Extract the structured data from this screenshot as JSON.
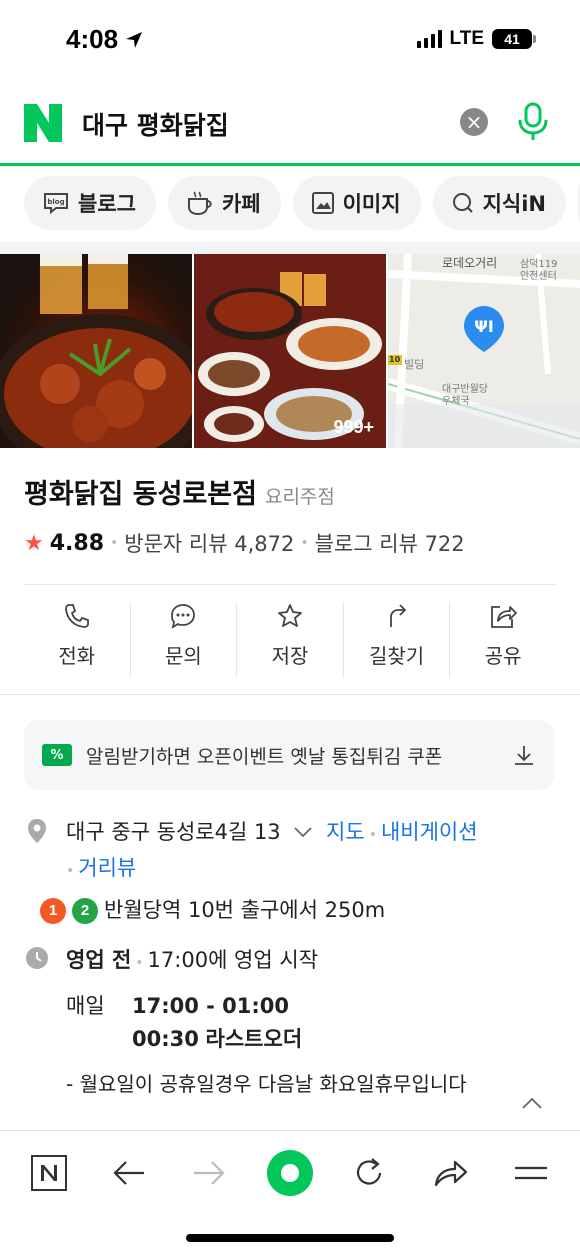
{
  "status_bar": {
    "time": "4:08",
    "network": "LTE",
    "battery": "41"
  },
  "search": {
    "query": "대구 평화닭집",
    "clear_label": "×"
  },
  "chips": [
    {
      "label": "블로그",
      "icon": "blog-icon"
    },
    {
      "label": "카페",
      "icon": "cafe-cup-icon"
    },
    {
      "label": "이미지",
      "icon": "image-icon"
    },
    {
      "label": "지식iN",
      "icon": "knowledge-icon"
    }
  ],
  "photos": {
    "more_count": "999+"
  },
  "map_labels": {
    "street": "로데오거리",
    "fire_station": "삼덕119\n안전센터",
    "bus": "10",
    "building": "빌딩",
    "post_office": "대구반월당\n우체국"
  },
  "place": {
    "name": "평화닭집 동성로본점",
    "category": "요리주점",
    "star": "★",
    "rating": "4.88",
    "visitor_reviews": "방문자 리뷰 4,872",
    "blog_reviews": "블로그 리뷰 722"
  },
  "actions": [
    {
      "label": "전화",
      "icon": "phone-icon"
    },
    {
      "label": "문의",
      "icon": "chat-icon"
    },
    {
      "label": "저장",
      "icon": "star-icon"
    },
    {
      "label": "길찾기",
      "icon": "directions-icon"
    },
    {
      "label": "공유",
      "icon": "share-icon"
    }
  ],
  "coupon": {
    "badge": "%",
    "text": "알림받기하면 오픈이벤트 옛날 통집튀김 쿠폰"
  },
  "address": {
    "text": "대구 중구 동성로4길 13",
    "map_link": "지도",
    "nav_link": "내비게이션",
    "street_link": "거리뷰",
    "line1": "1",
    "line2": "2",
    "line1_color": "#f15a22",
    "line2_color": "#24a444",
    "subway_text": "반월당역 10번 출구에서 250m"
  },
  "hours": {
    "status": "영업 전",
    "detail": "17:00에 영업 시작",
    "day": "매일",
    "time_range": "17:00 - 01:00",
    "last_order_time": "00:30",
    "last_order_label": "라스트오더",
    "note": "- 월요일이 공휴일경우 다음날 화요일휴무입니다"
  },
  "colors": {
    "brand": "#03c75a",
    "link": "#1a73e8",
    "star": "#ff5245"
  }
}
